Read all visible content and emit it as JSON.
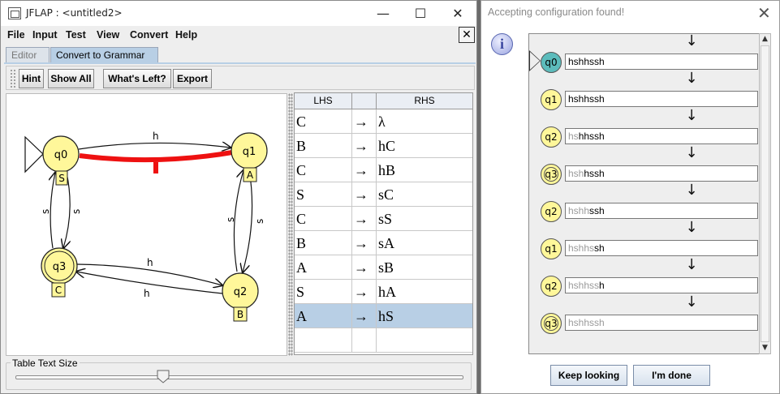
{
  "main_window": {
    "title": "JFLAP : <untitled2>",
    "controls": {
      "minimize": "—",
      "maximize": "☐",
      "close": "✕"
    },
    "menus": [
      "File",
      "Input",
      "Test",
      "View",
      "Convert",
      "Help"
    ],
    "close_panel": "✕",
    "tabs": [
      "Editor",
      "Convert to Grammar"
    ],
    "active_tab": "Convert to Grammar",
    "toolbar": [
      "Hint",
      "Show All",
      "What's Left?",
      "Export"
    ]
  },
  "automaton": {
    "states": [
      {
        "id": "q0",
        "label": "q0",
        "tag": "S",
        "initial": true,
        "final": false
      },
      {
        "id": "q1",
        "label": "q1",
        "tag": "A",
        "initial": false,
        "final": false
      },
      {
        "id": "q2",
        "label": "q2",
        "tag": "B",
        "initial": false,
        "final": false
      },
      {
        "id": "q3",
        "label": "q3",
        "tag": "C",
        "initial": false,
        "final": true
      }
    ],
    "transitions": [
      {
        "from": "q0",
        "to": "q1",
        "symbol": "h",
        "highlighted": false
      },
      {
        "from": "q1",
        "to": "q0",
        "symbol": "h",
        "highlighted": true
      },
      {
        "from": "q0",
        "to": "q3",
        "symbol": "s"
      },
      {
        "from": "q3",
        "to": "q0",
        "symbol": "s"
      },
      {
        "from": "q1",
        "to": "q2",
        "symbol": "s"
      },
      {
        "from": "q2",
        "to": "q1",
        "symbol": "s"
      },
      {
        "from": "q3",
        "to": "q2",
        "symbol": "h"
      },
      {
        "from": "q2",
        "to": "q3",
        "symbol": "h"
      }
    ],
    "highlight_color": "#ee1111",
    "state_color": "#fff79a"
  },
  "grammar_table": {
    "headers": [
      "LHS",
      "",
      "RHS"
    ],
    "arrow": "→",
    "rows": [
      {
        "lhs": "C",
        "rhs": "λ"
      },
      {
        "lhs": "B",
        "rhs": "hC"
      },
      {
        "lhs": "C",
        "rhs": "hB"
      },
      {
        "lhs": "S",
        "rhs": "sC"
      },
      {
        "lhs": "C",
        "rhs": "sS"
      },
      {
        "lhs": "B",
        "rhs": "sA"
      },
      {
        "lhs": "A",
        "rhs": "sB"
      },
      {
        "lhs": "S",
        "rhs": "hA"
      },
      {
        "lhs": "A",
        "rhs": "hS",
        "selected": true
      }
    ]
  },
  "table_text_size": {
    "label": "Table Text Size",
    "value_fraction": 0.33
  },
  "dialog": {
    "title": "Accepting configuration found!",
    "close": "✕",
    "info_icon": "i",
    "configurations": [
      {
        "state": "q0",
        "consumed": "",
        "remaining": "hshhssh",
        "start": true,
        "final": false
      },
      {
        "state": "q1",
        "consumed": "",
        "remaining": "hshhssh",
        "start": false,
        "final": false
      },
      {
        "state": "q2",
        "consumed": "hs",
        "remaining": "hhssh",
        "start": false,
        "final": false
      },
      {
        "state": "q3",
        "consumed": "hsh",
        "remaining": "hssh",
        "start": false,
        "final": true
      },
      {
        "state": "q2",
        "consumed": "hshh",
        "remaining": "ssh",
        "start": false,
        "final": false
      },
      {
        "state": "q1",
        "consumed": "hshhs",
        "remaining": "sh",
        "start": false,
        "final": false
      },
      {
        "state": "q2",
        "consumed": "hshhss",
        "remaining": "h",
        "start": false,
        "final": false
      },
      {
        "state": "q3",
        "consumed": "hshhssh",
        "remaining": "",
        "start": false,
        "final": true
      }
    ],
    "down_arrow": "↓",
    "buttons": [
      "Keep looking",
      "I'm done"
    ]
  }
}
